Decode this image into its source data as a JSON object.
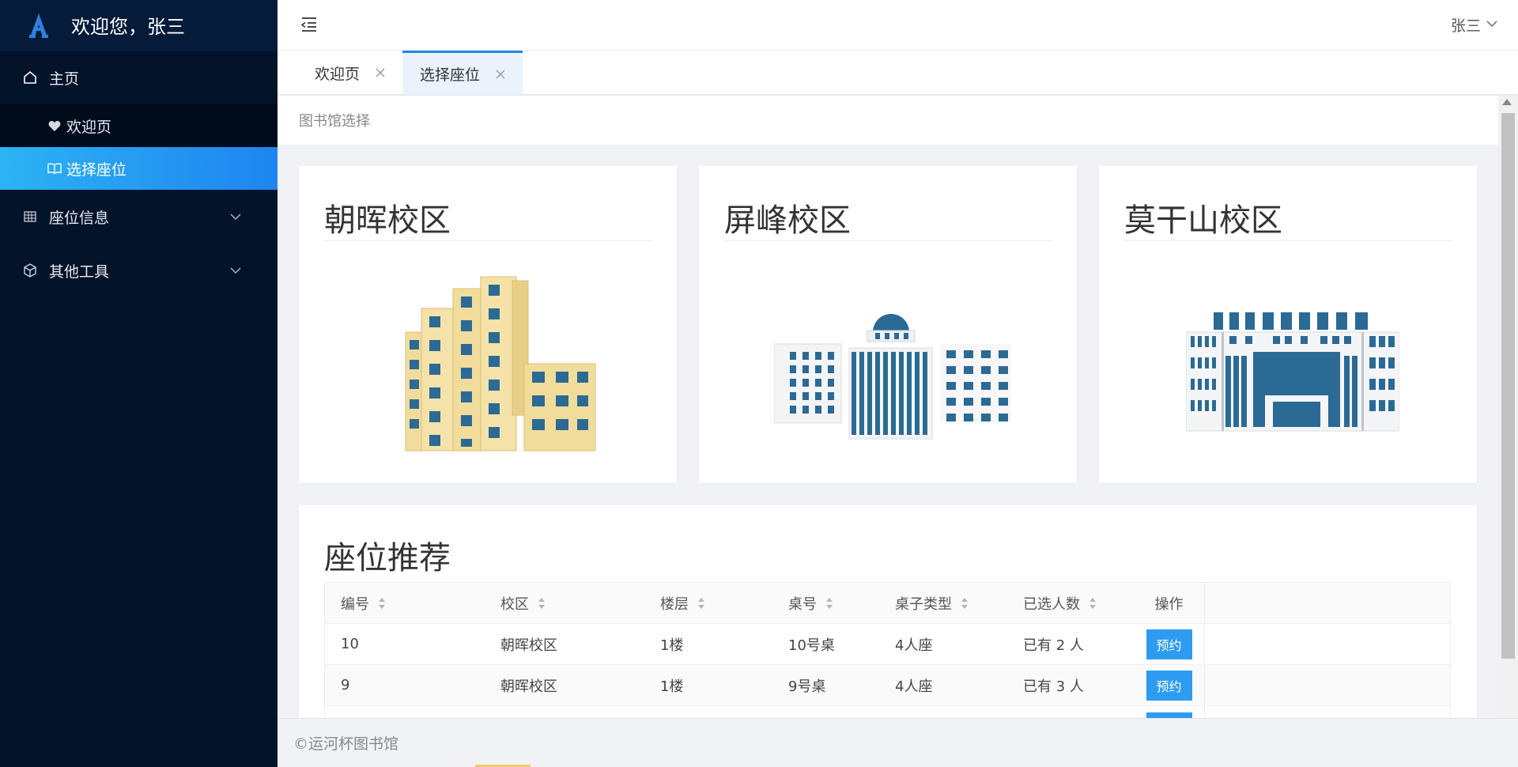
{
  "sidebar": {
    "title": "欢迎您，张三",
    "home_label": "主页",
    "sub_items": [
      {
        "label": "欢迎页",
        "icon": "heart-icon"
      },
      {
        "label": "选择座位",
        "icon": "book-icon"
      }
    ],
    "seat_info_label": "座位信息",
    "tools_label": "其他工具"
  },
  "header": {
    "user_name": "张三"
  },
  "tabs": [
    {
      "label": "欢迎页"
    },
    {
      "label": "选择座位"
    }
  ],
  "breadcrumb": "图书馆选择",
  "campuses": [
    {
      "name": "朝晖校区"
    },
    {
      "name": "屏峰校区"
    },
    {
      "name": "莫干山校区"
    }
  ],
  "recommend": {
    "title": "座位推荐",
    "columns": [
      "编号",
      "校区",
      "楼层",
      "桌号",
      "桌子类型",
      "已选人数",
      "操作"
    ],
    "rows": [
      {
        "id": "10",
        "campus": "朝晖校区",
        "floor": "1楼",
        "desk": "10号桌",
        "type": "4人座",
        "count": "已有 2 人",
        "action": "预约"
      },
      {
        "id": "9",
        "campus": "朝晖校区",
        "floor": "1楼",
        "desk": "9号桌",
        "type": "4人座",
        "count": "已有 3 人",
        "action": "预约"
      }
    ]
  },
  "footer": "©运河杯图书馆",
  "colors": {
    "sidebar": "#031329",
    "accent": "#1e88e5",
    "button": "#2d9cf0",
    "building_blue": "#2b6a94",
    "building_tan": "#f2dc9b"
  }
}
